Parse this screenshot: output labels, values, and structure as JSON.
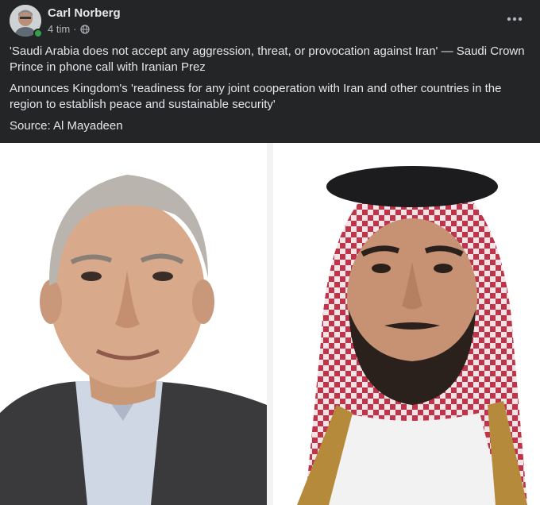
{
  "post": {
    "author": "Carl Norberg",
    "time": "4 tim",
    "separator": "·",
    "icons": {
      "privacy": "globe-icon",
      "more": "more-horizontal-icon"
    },
    "paragraphs": [
      "'Saudi Arabia does not accept any aggression, threat, or provocation against Iran' — Saudi Crown Prince in phone call with Iranian Prez",
      "Announces Kingdom's 'readiness for any joint cooperation with Iran and other countries in the region to establish peace and sustainable security'",
      "Source: Al Mayadeen"
    ]
  },
  "colors": {
    "background": "#242526",
    "text": "#e4e6eb",
    "secondary": "#b0b3b8",
    "online": "#31a24c"
  }
}
